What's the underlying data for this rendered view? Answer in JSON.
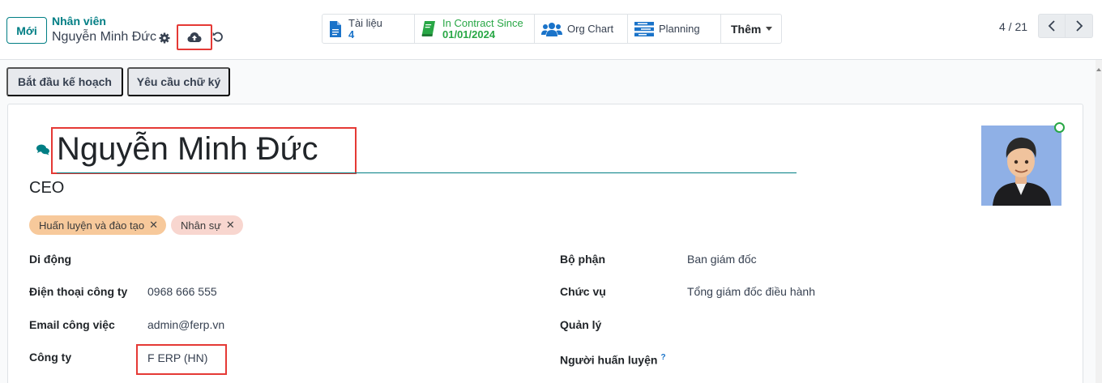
{
  "toolbar": {
    "new_label": "Mới",
    "breadcrumb_parent": "Nhân viên",
    "breadcrumb_current": "Nguyễn Minh Đức"
  },
  "smart_buttons": {
    "documents": {
      "label": "Tài liệu",
      "value": "4"
    },
    "contract": {
      "label": "In Contract Since",
      "value": "01/01/2024"
    },
    "org_chart": {
      "label": "Org Chart"
    },
    "planning": {
      "label": "Planning"
    },
    "more": {
      "label": "Thêm"
    }
  },
  "pager": {
    "text": "4 / 21"
  },
  "actions": {
    "start_plan": "Bắt đầu kế hoạch",
    "request_signature": "Yêu cầu chữ ký"
  },
  "employee": {
    "name": "Nguyễn Minh Đức",
    "job_title": "CEO",
    "tags": [
      {
        "label": "Huấn luyện và đào tạo",
        "color": "#f7c99b"
      },
      {
        "label": "Nhân sự",
        "color": "#f8d6cf"
      }
    ]
  },
  "fields_left": [
    {
      "label": "Di động",
      "value": ""
    },
    {
      "label": "Điện thoại công ty",
      "value": "0968 666 555"
    },
    {
      "label": "Email công việc",
      "value": "admin@ferp.vn"
    },
    {
      "label": "Công ty",
      "value": "F ERP (HN)"
    }
  ],
  "fields_right": [
    {
      "label": "Bộ phận",
      "value": "Ban giám đốc"
    },
    {
      "label": "Chức vụ",
      "value": "Tổng giám đốc điều hành"
    },
    {
      "label": "Quản lý",
      "value": ""
    },
    {
      "label": "Người huấn luyện",
      "value": "",
      "help": "?"
    }
  ],
  "colors": {
    "accent": "#017e84",
    "highlight": "#e53935",
    "link": "#1a73c9",
    "success": "#28a745"
  }
}
